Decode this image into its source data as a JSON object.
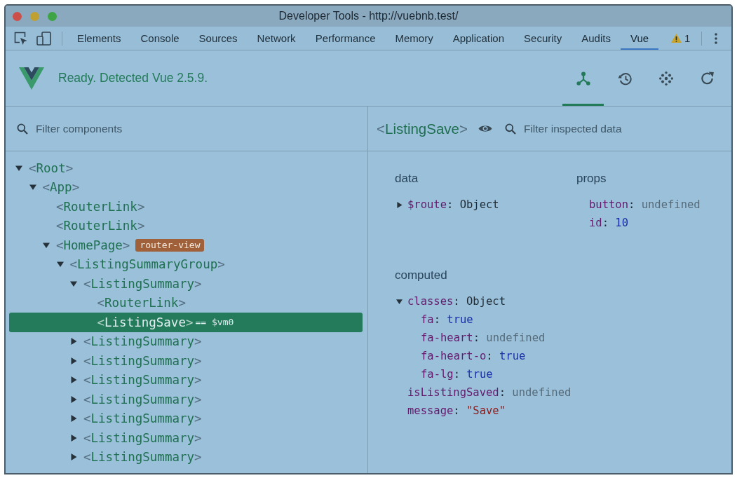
{
  "window": {
    "title": "Developer Tools - http://vuebnb.test/"
  },
  "toolbar": {
    "tabs": [
      {
        "label": "Elements",
        "selected": false
      },
      {
        "label": "Console",
        "selected": false
      },
      {
        "label": "Sources",
        "selected": false
      },
      {
        "label": "Network",
        "selected": false
      },
      {
        "label": "Performance",
        "selected": false
      },
      {
        "label": "Memory",
        "selected": false
      },
      {
        "label": "Application",
        "selected": false
      },
      {
        "label": "Security",
        "selected": false
      },
      {
        "label": "Audits",
        "selected": false
      },
      {
        "label": "Vue",
        "selected": true
      }
    ],
    "warnings": {
      "count": "1"
    }
  },
  "vue_header": {
    "status": "Ready. Detected Vue 2.5.9.",
    "views": [
      {
        "kind": "components",
        "selected": true
      },
      {
        "kind": "history",
        "selected": false
      },
      {
        "kind": "events",
        "selected": false
      }
    ]
  },
  "components_pane": {
    "filter": {
      "placeholder": "Filter components"
    },
    "tree": [
      {
        "label": "<Root>",
        "selected": false,
        "expanded": true,
        "children": [
          {
            "label": "<App>",
            "selected": false,
            "expanded": true,
            "children": [
              {
                "label": "<RouterLink>",
                "selected": false
              },
              {
                "label": "<RouterLink>",
                "selected": false
              },
              {
                "label": "<HomePage>",
                "selected": false,
                "tag": "router-view",
                "expanded": true,
                "children": [
                  {
                    "label": "<ListingSummaryGroup>",
                    "selected": false,
                    "expanded": true,
                    "children": [
                      {
                        "label": "<ListingSummary>",
                        "selected": false,
                        "expanded": true,
                        "children": [
                          {
                            "label": "<RouterLink>",
                            "selected": false
                          },
                          {
                            "label": "<ListingSave>",
                            "selected": true,
                            "note": "== $vm0"
                          }
                        ]
                      },
                      {
                        "label": "<ListingSummary>",
                        "selected": false,
                        "expanded": false
                      },
                      {
                        "label": "<ListingSummary>",
                        "selected": false,
                        "expanded": false
                      },
                      {
                        "label": "<ListingSummary>",
                        "selected": false,
                        "expanded": false
                      },
                      {
                        "label": "<ListingSummary>",
                        "selected": false,
                        "expanded": false
                      },
                      {
                        "label": "<ListingSummary>",
                        "selected": false,
                        "expanded": false
                      },
                      {
                        "label": "<ListingSummary>",
                        "selected": false,
                        "expanded": false
                      },
                      {
                        "label": "<ListingSummary>",
                        "selected": false,
                        "expanded": false
                      }
                    ]
                  }
                ]
              }
            ]
          }
        ]
      }
    ]
  },
  "inspector": {
    "component": "<ListingSave>",
    "filter": {
      "placeholder": "Filter inspected data"
    },
    "sections": [
      {
        "title": "data",
        "items": [
          {
            "key": "$route:",
            "value": "Object",
            "kind": "object",
            "expanded": false
          }
        ]
      },
      {
        "title": "props",
        "items": [
          {
            "key": "button:",
            "value": "undefined",
            "kind": "undefined"
          },
          {
            "key": "id:",
            "value": "10",
            "kind": "number"
          }
        ]
      },
      {
        "title": "computed",
        "items": [
          {
            "key": "classes:",
            "value": "Object",
            "kind": "object",
            "expanded": true,
            "children": [
              {
                "key": "fa:",
                "value": "true",
                "kind": "boolean"
              },
              {
                "key": "fa-heart:",
                "value": "undefined",
                "kind": "undefined"
              },
              {
                "key": "fa-heart-o:",
                "value": "true",
                "kind": "boolean"
              },
              {
                "key": "fa-lg:",
                "value": "true",
                "kind": "boolean"
              }
            ]
          },
          {
            "key": "isListingSaved:",
            "value": "undefined",
            "kind": "undefined"
          },
          {
            "key": "message:",
            "value": "\"Save\"",
            "kind": "string"
          }
        ]
      }
    ]
  }
}
